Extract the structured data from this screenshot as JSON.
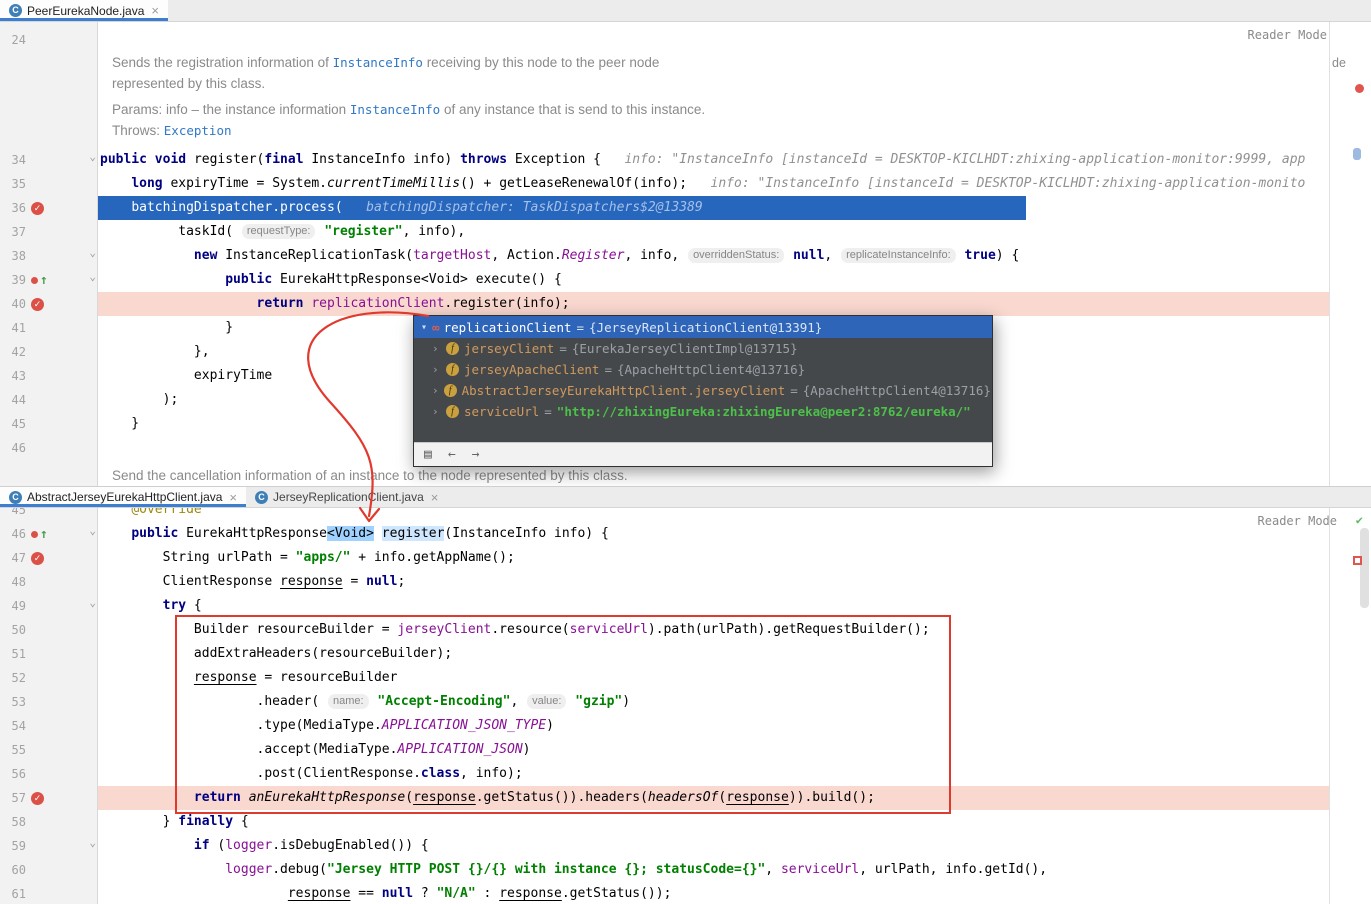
{
  "colors": {
    "execution_line": "#2766BD",
    "breakpoint_line": "#F9D8CF",
    "breakpoint": "#DB5147",
    "annotation_red": "#E03A2F",
    "selection_blue": "#9FD2FF",
    "popup_background": "#45484B",
    "popup_header": "#2F65B8",
    "string_green": "#008000",
    "field_purple": "#871094",
    "keyword_navy": "#000080"
  },
  "icons": {
    "class_letter": "C",
    "close": "×",
    "fold": "⌄",
    "bp_check": "✓",
    "exec_arrow": "↑",
    "chevron_right": "›",
    "chevron_down": "▾",
    "watches": "∞",
    "field_letter": "f",
    "reader_check": "✔"
  },
  "top": {
    "tab": "PeerEurekaNode.java",
    "reader_mode": "Reader Mode",
    "right_clipped_text": "de",
    "javadoc": [
      {
        "seg": [
          [
            "d",
            "Sends the registration information of "
          ],
          [
            "r",
            "InstanceInfo"
          ],
          [
            "d",
            " receiving by this node to the peer node"
          ]
        ]
      },
      {
        "seg": [
          [
            "d",
            "represented by this class."
          ]
        ]
      },
      {
        "gap": true,
        "seg": [
          [
            "dl",
            "Params:"
          ],
          [
            "d",
            " info – the instance information "
          ],
          [
            "r",
            "InstanceInfo"
          ],
          [
            "d",
            " of any instance that is send to this instance."
          ]
        ]
      },
      {
        "seg": [
          [
            "dl",
            "Throws:"
          ],
          [
            "d",
            " "
          ],
          [
            "r",
            "Exception"
          ]
        ]
      }
    ],
    "lines_before_doc": [
      {
        "n": 24,
        "seg": []
      }
    ],
    "lines": [
      {
        "n": 34,
        "fold": true,
        "seg": [
          [
            "k",
            "public "
          ],
          [
            "k",
            "void "
          ],
          [
            "t",
            "register("
          ],
          [
            "k",
            "final "
          ],
          [
            "t",
            "InstanceInfo info) "
          ],
          [
            "k",
            "throws "
          ],
          [
            "t",
            "Exception {"
          ],
          [
            "hint",
            "   info: \"InstanceInfo [instanceId = DESKTOP-KICLHDT:zhixing-application-monitor:9999, app"
          ]
        ]
      },
      {
        "n": 35,
        "seg": [
          [
            "t",
            "    "
          ],
          [
            "k",
            "long"
          ],
          [
            "t",
            " expiryTime = System."
          ],
          [
            "i",
            "currentTimeMillis"
          ],
          [
            "t",
            "() + getLeaseRenewalOf(info);"
          ],
          [
            "hint",
            "   info: \"InstanceInfo [instanceId = DESKTOP-KICLHDT:zhixing-application-monito"
          ]
        ]
      },
      {
        "n": 36,
        "hl": "exec",
        "icon": "bp",
        "seg": [
          [
            "t",
            "    "
          ],
          [
            "f",
            "batchingDispatcher"
          ],
          [
            "t",
            ".process("
          ],
          [
            "hint",
            "   batchingDispatcher: TaskDispatchers$2@13389"
          ]
        ]
      },
      {
        "n": 37,
        "seg": [
          [
            "t",
            "          taskId( "
          ],
          [
            "chip",
            "requestType:"
          ],
          [
            "t",
            " "
          ],
          [
            "s",
            "\"register\""
          ],
          [
            "t",
            ", info),"
          ]
        ]
      },
      {
        "n": 38,
        "fold": true,
        "seg": [
          [
            "t",
            "            "
          ],
          [
            "k",
            "new "
          ],
          [
            "t",
            "InstanceReplicationTask("
          ],
          [
            "f",
            "targetHost"
          ],
          [
            "t",
            ", Action."
          ],
          [
            "fi",
            "Register"
          ],
          [
            "t",
            ", info, "
          ],
          [
            "chip",
            "overriddenStatus:"
          ],
          [
            "t",
            " "
          ],
          [
            "k",
            "null"
          ],
          [
            "t",
            ", "
          ],
          [
            "chip",
            "replicateInstanceInfo:"
          ],
          [
            "t",
            " "
          ],
          [
            "k",
            "true"
          ],
          [
            "t",
            ") {"
          ]
        ]
      },
      {
        "n": 39,
        "icon": "dbg",
        "fold": true,
        "seg": [
          [
            "t",
            "                "
          ],
          [
            "k",
            "public "
          ],
          [
            "t",
            "EurekaHttpResponse<Void> execute() {"
          ]
        ]
      },
      {
        "n": 40,
        "hl": "salmon",
        "icon": "bp",
        "seg": [
          [
            "t",
            "                    "
          ],
          [
            "k",
            "return "
          ],
          [
            "f",
            "replicationClient"
          ],
          [
            "t",
            ".register(info);"
          ]
        ]
      },
      {
        "n": 41,
        "seg": [
          [
            "t",
            "                }"
          ]
        ]
      },
      {
        "n": 42,
        "seg": [
          [
            "t",
            "            },"
          ]
        ]
      },
      {
        "n": 43,
        "seg": [
          [
            "t",
            "            expiryTime"
          ]
        ]
      },
      {
        "n": 44,
        "seg": [
          [
            "t",
            "        );"
          ]
        ]
      },
      {
        "n": 45,
        "seg": [
          [
            "t",
            "    }"
          ]
        ]
      },
      {
        "n": 46,
        "seg": []
      }
    ],
    "partial_doc": "Send the cancellation information of an instance to the node represented by this class.",
    "popup": {
      "header": {
        "name": "replicationClient",
        "eq": " = ",
        "value": "{JerseyReplicationClient@13391}"
      },
      "rows": [
        {
          "name": "jerseyClient",
          "value": "{EurekaJerseyClientImpl@13715}"
        },
        {
          "name": "jerseyApacheClient",
          "value": "{ApacheHttpClient4@13716}"
        },
        {
          "name": "AbstractJerseyEurekaHttpClient.jerseyClient",
          "value": "{ApacheHttpClient4@13716}"
        },
        {
          "name": "serviceUrl",
          "value": "\"http://zhixingEureka:zhixingEureka@peer2:8762/eureka/\"",
          "green": true
        }
      ],
      "footer_icons": [
        {
          "name": "variables-view-icon",
          "glyph": "▤"
        },
        {
          "name": "back-arrow-icon",
          "glyph": "←"
        },
        {
          "name": "forward-arrow-icon",
          "glyph": "→"
        }
      ]
    }
  },
  "bottom": {
    "tabs": [
      "AbstractJerseyEurekaHttpClient.java",
      "JerseyReplicationClient.java"
    ],
    "reader_mode": "Reader Mode",
    "lines": [
      {
        "n": 45,
        "seg": [
          [
            "t",
            "    "
          ],
          [
            "an",
            "@Override"
          ]
        ]
      },
      {
        "n": 46,
        "icon": "dbg",
        "fold": true,
        "seg": [
          [
            "t",
            "    "
          ],
          [
            "k",
            "public "
          ],
          [
            "t",
            "EurekaHttpResponse"
          ],
          [
            "t sel1",
            "<Void>"
          ],
          [
            "t",
            " "
          ],
          [
            "t sel2",
            "register"
          ],
          [
            "t",
            "(InstanceInfo info) {"
          ]
        ]
      },
      {
        "n": 47,
        "icon": "bp",
        "seg": [
          [
            "t",
            "        String urlPath = "
          ],
          [
            "s",
            "\"apps/\""
          ],
          [
            "t",
            " + info.getAppName();"
          ]
        ]
      },
      {
        "n": 48,
        "seg": [
          [
            "t",
            "        ClientResponse "
          ],
          [
            "u",
            "response"
          ],
          [
            "t",
            " = "
          ],
          [
            "k",
            "null"
          ],
          [
            "t",
            ";"
          ]
        ]
      },
      {
        "n": 49,
        "fold": true,
        "seg": [
          [
            "t",
            "        "
          ],
          [
            "k",
            "try"
          ],
          [
            "t",
            " {"
          ]
        ]
      },
      {
        "n": 50,
        "seg": [
          [
            "t",
            "            Builder resourceBuilder = "
          ],
          [
            "f",
            "jerseyClient"
          ],
          [
            "t",
            ".resource("
          ],
          [
            "f",
            "serviceUrl"
          ],
          [
            "t",
            ").path(urlPath).getRequestBuilder();"
          ]
        ]
      },
      {
        "n": 51,
        "seg": [
          [
            "t",
            "            addExtraHeaders(resourceBuilder);"
          ]
        ]
      },
      {
        "n": 52,
        "seg": [
          [
            "t",
            "            "
          ],
          [
            "u",
            "response"
          ],
          [
            "t",
            " = resourceBuilder"
          ]
        ]
      },
      {
        "n": 53,
        "seg": [
          [
            "t",
            "                    .header( "
          ],
          [
            "chip",
            "name:"
          ],
          [
            "t",
            " "
          ],
          [
            "s",
            "\"Accept-Encoding\""
          ],
          [
            "t",
            ", "
          ],
          [
            "chip",
            "value:"
          ],
          [
            "t",
            " "
          ],
          [
            "s",
            "\"gzip\""
          ],
          [
            "t",
            ")"
          ]
        ]
      },
      {
        "n": 54,
        "seg": [
          [
            "t",
            "                    .type(MediaType."
          ],
          [
            "fi",
            "APPLICATION_JSON_TYPE"
          ],
          [
            "t",
            ")"
          ]
        ]
      },
      {
        "n": 55,
        "seg": [
          [
            "t",
            "                    .accept(MediaType."
          ],
          [
            "fi",
            "APPLICATION_JSON"
          ],
          [
            "t",
            ")"
          ]
        ]
      },
      {
        "n": 56,
        "seg": [
          [
            "t",
            "                    .post(ClientResponse."
          ],
          [
            "k",
            "class"
          ],
          [
            "t",
            ", info);"
          ]
        ]
      },
      {
        "n": 57,
        "hl": "salmon",
        "icon": "bp",
        "seg": [
          [
            "t",
            "            "
          ],
          [
            "k",
            "return "
          ],
          [
            "i",
            "anEurekaHttpResponse"
          ],
          [
            "t",
            "("
          ],
          [
            "u",
            "response"
          ],
          [
            "t",
            ".getStatus()).headers("
          ],
          [
            "i",
            "headersOf"
          ],
          [
            "t",
            "("
          ],
          [
            "u",
            "response"
          ],
          [
            "t",
            ")).build();"
          ]
        ]
      },
      {
        "n": 58,
        "seg": [
          [
            "t",
            "        } "
          ],
          [
            "k",
            "finally"
          ],
          [
            "t",
            " {"
          ]
        ]
      },
      {
        "n": 59,
        "fold": true,
        "seg": [
          [
            "t",
            "            "
          ],
          [
            "k",
            "if"
          ],
          [
            "t",
            " ("
          ],
          [
            "f",
            "logger"
          ],
          [
            "t",
            ".isDebugEnabled()) {"
          ]
        ]
      },
      {
        "n": 60,
        "seg": [
          [
            "t",
            "                "
          ],
          [
            "f",
            "logger"
          ],
          [
            "t",
            ".debug("
          ],
          [
            "s",
            "\"Jersey HTTP POST {}/{} with instance {}; statusCode={}\""
          ],
          [
            "t",
            ", "
          ],
          [
            "f",
            "serviceUrl"
          ],
          [
            "t",
            ", urlPath, info.getId(),"
          ]
        ]
      },
      {
        "n": 61,
        "seg": [
          [
            "t",
            "                        "
          ],
          [
            "u",
            "response"
          ],
          [
            "t",
            " == "
          ],
          [
            "k",
            "null"
          ],
          [
            "t",
            " ? "
          ],
          [
            "s",
            "\"N/A\""
          ],
          [
            "t",
            " : "
          ],
          [
            "u",
            "response"
          ],
          [
            "t",
            ".getStatus());"
          ]
        ]
      }
    ]
  }
}
